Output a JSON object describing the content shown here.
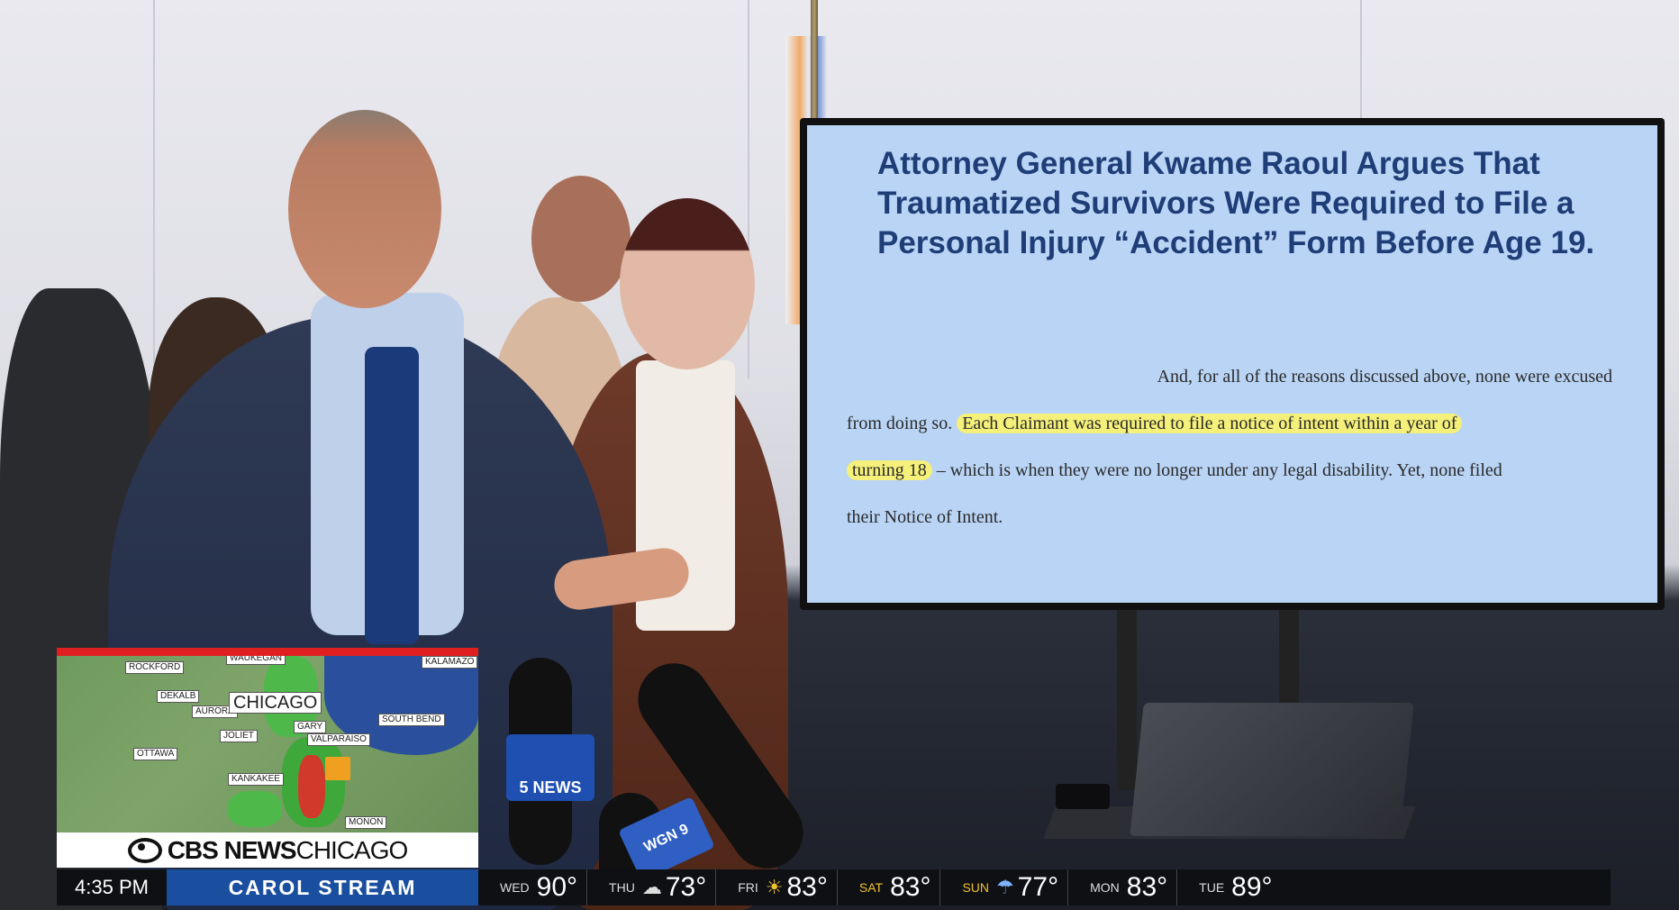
{
  "slide": {
    "title": "Attorney General Kwame Raoul Argues That Traumatized Survivors Were Required to File a Personal Injury “Accident” Form Before Age 19.",
    "body_plain_1": "And, for all of the reasons discussed above, none were excused",
    "body_plain_2": "from doing so. ",
    "body_highlight_1": "Each Claimant was required to file a notice of intent within a year of",
    "body_highlight_2": "turning 18",
    "body_plain_3": " – which is when they were no longer under any legal disability. Yet, none filed",
    "body_plain_4": "their Notice of Intent."
  },
  "map": {
    "cities": {
      "rockford": "ROCKFORD",
      "waukegan": "WAUKEGAN",
      "kalamazoo": "KALAMAZO",
      "dekalb": "DEKALB",
      "aurora": "AURORA",
      "chicago": "CHICAGO",
      "south_bend": "SOUTH BEND",
      "gary": "GARY",
      "joliet": "JOLIET",
      "valparaiso": "VALPARAISO",
      "ottawa": "OTTAWA",
      "kankakee": "KANKAKEE",
      "monon": "MONON"
    }
  },
  "brand": {
    "network": "CBS NEWS",
    "market": "CHICAGO"
  },
  "ticker": {
    "time": "4:35 PM",
    "location": "CAROL STREAM",
    "forecast": [
      {
        "day": "WED",
        "icon": "",
        "temp": "90°"
      },
      {
        "day": "THU",
        "icon": "cloud-icon",
        "temp": "73°"
      },
      {
        "day": "FRI",
        "icon": "sun-icon",
        "temp": "83°"
      },
      {
        "day": "SAT",
        "icon": "",
        "temp": "83°"
      },
      {
        "day": "SUN",
        "icon": "rain-icon",
        "temp": "77°"
      },
      {
        "day": "MON",
        "icon": "",
        "temp": "83°"
      },
      {
        "day": "TUE",
        "icon": "",
        "temp": "89°"
      }
    ]
  },
  "mic_flags": {
    "nbc": "5 NEWS",
    "wgn": "WGN 9"
  }
}
